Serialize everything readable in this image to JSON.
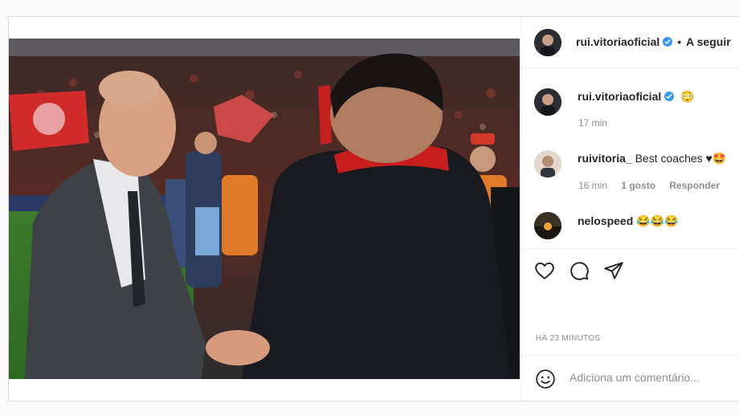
{
  "post": {
    "author": "rui.vitoriaoficial",
    "follow_separator": "•",
    "follow_label": "A seguir"
  },
  "comments": [
    {
      "user": "rui.vitoriaoficial",
      "text": "😳",
      "time": "17 min",
      "likes": "",
      "reply": ""
    },
    {
      "user": "ruivitoria_",
      "text": "Best coaches ♥🤩",
      "time": "16 min",
      "likes": "1 gosto",
      "reply": "Responder"
    },
    {
      "user": "nelospeed",
      "text": "😂😂😂",
      "time": "",
      "likes": "",
      "reply": ""
    }
  ],
  "icons": {
    "like": "heart-icon",
    "comment": "comment-icon",
    "share": "paper-plane-icon",
    "emoji": "emoji-icon",
    "verified": "verified-badge-icon"
  },
  "timestamp": "HÁ 23 MINUTOS",
  "add_comment": {
    "placeholder": "Adiciona um comentário..."
  },
  "colors": {
    "verified": "#3897f0",
    "muted": "#8e8e8e",
    "text": "#262626"
  }
}
